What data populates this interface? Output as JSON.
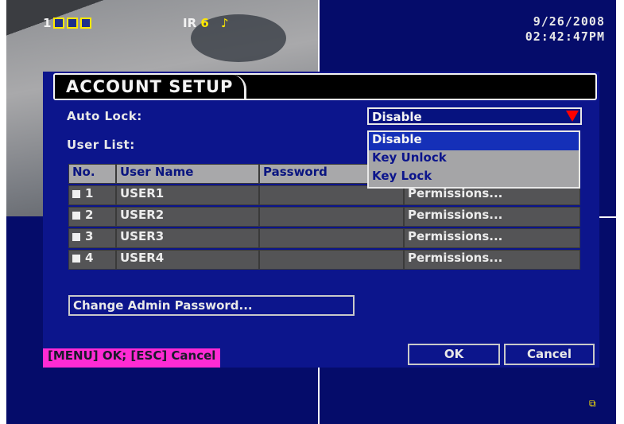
{
  "overlay": {
    "channel": "1",
    "ir_label": "IR",
    "ir_value": "6",
    "date": "9/26/2008",
    "time": "02:42:47PM"
  },
  "dialog": {
    "title": "ACCOUNT SETUP",
    "auto_lock_label": "Auto Lock:",
    "auto_lock_value": "Disable",
    "auto_lock_options": [
      "Disable",
      "Key Unlock",
      "Key Lock"
    ],
    "user_list_label": "User List:",
    "table": {
      "headers": [
        "No.",
        "User Name",
        "Password",
        ""
      ],
      "rows": [
        {
          "no": "1",
          "user": "USER1",
          "password": "",
          "perm": "Permissions..."
        },
        {
          "no": "2",
          "user": "USER2",
          "password": "",
          "perm": "Permissions..."
        },
        {
          "no": "3",
          "user": "USER3",
          "password": "",
          "perm": "Permissions..."
        },
        {
          "no": "4",
          "user": "USER4",
          "password": "",
          "perm": "Permissions..."
        }
      ]
    },
    "change_admin_label": "Change Admin Password...",
    "hint": "[MENU] OK; [ESC] Cancel",
    "ok_label": "OK",
    "cancel_label": "Cancel"
  },
  "colors": {
    "background": "#050c6a",
    "highlight": "#ff2bd4",
    "accent": "#ffe800",
    "dropdown_arrow": "#ff0000"
  }
}
